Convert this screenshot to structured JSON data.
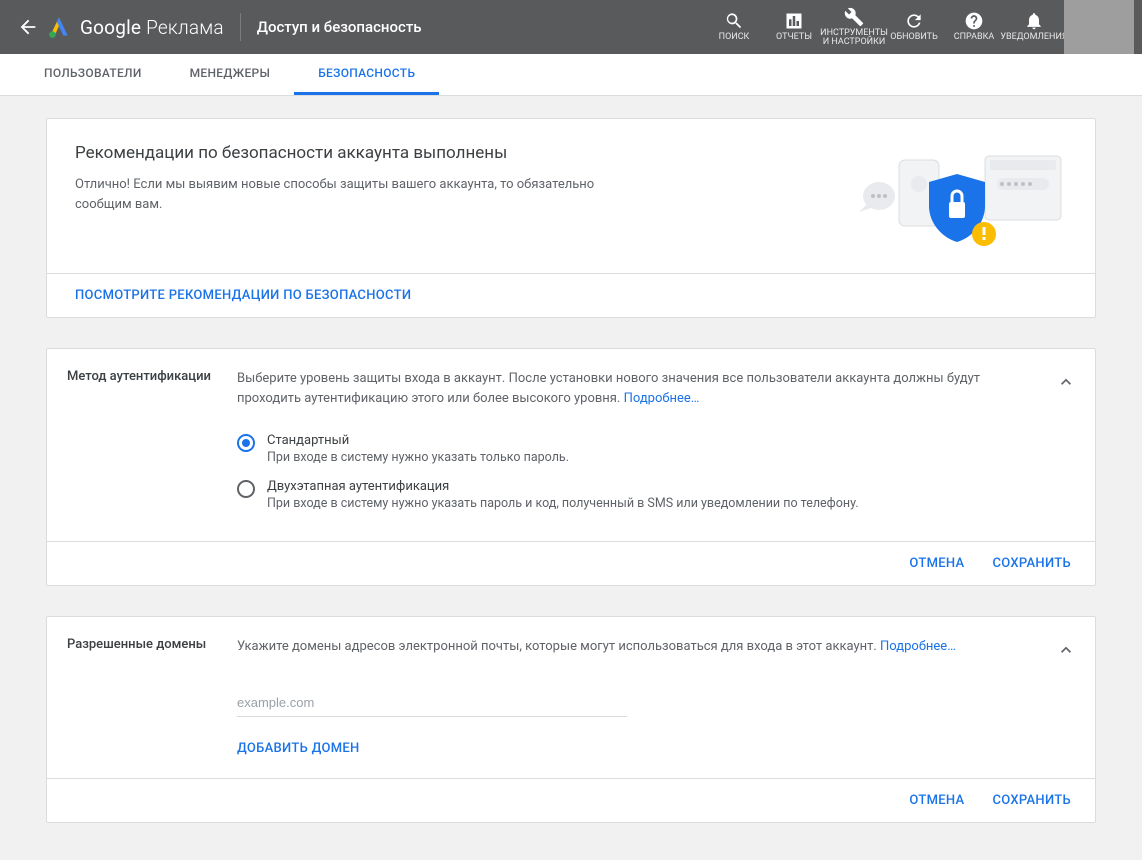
{
  "header": {
    "brand": "Google",
    "product": "Реклама",
    "page_title": "Доступ и безопасность",
    "icons": {
      "search": "ПОИСК",
      "reports": "ОТЧЕТЫ",
      "tools": "ИНСТРУМЕНТЫ И НАСТРОЙКИ",
      "refresh": "ОБНОВИТЬ",
      "help": "СПРАВКА",
      "notifications": "УВЕДОМЛЕНИЯ"
    }
  },
  "tabs": {
    "users": "ПОЛЬЗОВАТЕЛИ",
    "managers": "МЕНЕДЖЕРЫ",
    "security": "БЕЗОПАСНОСТЬ"
  },
  "recommend": {
    "title": "Рекомендации по безопасности аккаунта выполнены",
    "subtitle": "Отлично! Если мы выявим новые способы защиты вашего аккаунта, то обязательно сообщим вам.",
    "footer_link": "ПОСМОТРИТЕ РЕКОМЕНДАЦИИ ПО БЕЗОПАСНОСТИ"
  },
  "auth": {
    "label": "Метод аутентификации",
    "desc": "Выберите уровень защиты входа в аккаунт. После установки нового значения все пользователи аккаунта должны будут проходить аутентификацию этого или более высокого уровня. ",
    "learn_more": "Подробнее…",
    "options": [
      {
        "label": "Стандартный",
        "hint": "При входе в систему нужно указать только пароль.",
        "checked": true
      },
      {
        "label": "Двухэтапная аутентификация",
        "hint": "При входе в систему нужно указать пароль и код, полученный в SMS или уведомлении по телефону.",
        "checked": false
      }
    ],
    "cancel": "ОТМЕНА",
    "save": "СОХРАНИТЬ"
  },
  "domains": {
    "label": "Разрешенные домены",
    "desc": "Укажите домены адресов электронной почты, которые могут использоваться для входа в этот аккаунт. ",
    "learn_more": "Подробнее…",
    "placeholder": "example.com",
    "add": "ДОБАВИТЬ ДОМЕН",
    "cancel": "ОТМЕНА",
    "save": "СОХРАНИТЬ"
  }
}
